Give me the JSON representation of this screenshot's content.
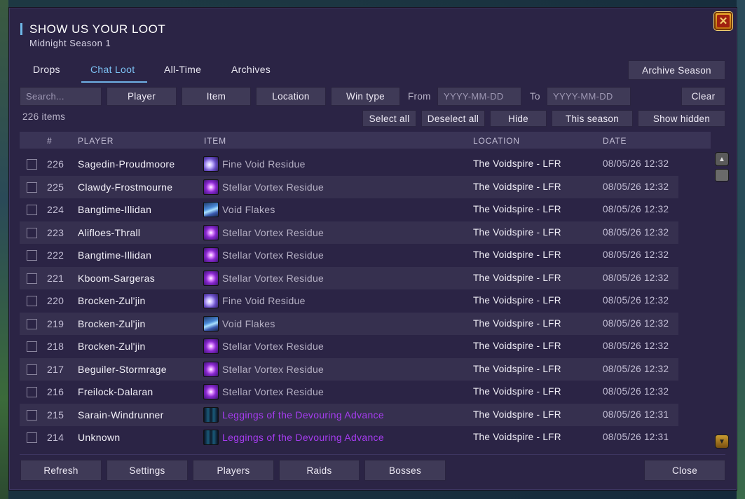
{
  "window": {
    "title": "SHOW US YOUR LOOT",
    "subtitle": "Midnight Season 1"
  },
  "tabs": [
    {
      "label": "Drops",
      "active": false
    },
    {
      "label": "Chat Loot",
      "active": true
    },
    {
      "label": "All-Time",
      "active": false
    },
    {
      "label": "Archives",
      "active": false
    }
  ],
  "archive_button": "Archive Season",
  "filters": {
    "search_placeholder": "Search...",
    "player": "Player",
    "item": "Item",
    "location": "Location",
    "win_type": "Win type",
    "from_label": "From",
    "from_placeholder": "YYYY-MM-DD",
    "to_label": "To",
    "to_placeholder": "YYYY-MM-DD",
    "clear": "Clear"
  },
  "count_text": "226 items",
  "actions": {
    "select_all": "Select all",
    "deselect_all": "Deselect all",
    "hide": "Hide",
    "this_season": "This season",
    "show_hidden": "Show hidden"
  },
  "columns": [
    "#",
    "PLAYER",
    "ITEM",
    "LOCATION",
    "DATE"
  ],
  "rows": [
    {
      "num": "226",
      "player": "Sagedin-Proudmoore",
      "icon": "fine-void-residue-icon",
      "item": "Fine Void Residue",
      "quality": "common",
      "location": "The Voidspire - LFR",
      "date": "08/05/26 12:32"
    },
    {
      "num": "225",
      "player": "Clawdy-Frostmourne",
      "icon": "stellar-vortex-residue-icon",
      "item": "Stellar Vortex Residue",
      "quality": "common",
      "location": "The Voidspire - LFR",
      "date": "08/05/26 12:32"
    },
    {
      "num": "224",
      "player": "Bangtime-Illidan",
      "icon": "void-flakes-icon",
      "item": "Void Flakes",
      "quality": "common",
      "location": "The Voidspire - LFR",
      "date": "08/05/26 12:32"
    },
    {
      "num": "223",
      "player": "Alifloes-Thrall",
      "icon": "stellar-vortex-residue-icon",
      "item": "Stellar Vortex Residue",
      "quality": "common",
      "location": "The Voidspire - LFR",
      "date": "08/05/26 12:32"
    },
    {
      "num": "222",
      "player": "Bangtime-Illidan",
      "icon": "stellar-vortex-residue-icon",
      "item": "Stellar Vortex Residue",
      "quality": "common",
      "location": "The Voidspire - LFR",
      "date": "08/05/26 12:32"
    },
    {
      "num": "221",
      "player": "Kboom-Sargeras",
      "icon": "stellar-vortex-residue-icon",
      "item": "Stellar Vortex Residue",
      "quality": "common",
      "location": "The Voidspire - LFR",
      "date": "08/05/26 12:32"
    },
    {
      "num": "220",
      "player": "Brocken-Zul'jin",
      "icon": "fine-void-residue-icon",
      "item": "Fine Void Residue",
      "quality": "common",
      "location": "The Voidspire - LFR",
      "date": "08/05/26 12:32"
    },
    {
      "num": "219",
      "player": "Brocken-Zul'jin",
      "icon": "void-flakes-icon",
      "item": "Void Flakes",
      "quality": "common",
      "location": "The Voidspire - LFR",
      "date": "08/05/26 12:32"
    },
    {
      "num": "218",
      "player": "Brocken-Zul'jin",
      "icon": "stellar-vortex-residue-icon",
      "item": "Stellar Vortex Residue",
      "quality": "common",
      "location": "The Voidspire - LFR",
      "date": "08/05/26 12:32"
    },
    {
      "num": "217",
      "player": "Beguiler-Stormrage",
      "icon": "stellar-vortex-residue-icon",
      "item": "Stellar Vortex Residue",
      "quality": "common",
      "location": "The Voidspire - LFR",
      "date": "08/05/26 12:32"
    },
    {
      "num": "216",
      "player": "Freilock-Dalaran",
      "icon": "stellar-vortex-residue-icon",
      "item": "Stellar Vortex Residue",
      "quality": "common",
      "location": "The Voidspire - LFR",
      "date": "08/05/26 12:32"
    },
    {
      "num": "215",
      "player": "Sarain-Windrunner",
      "icon": "leggings-icon",
      "item": "Leggings of the Devouring Advance",
      "quality": "epic",
      "location": "The Voidspire - LFR",
      "date": "08/05/26 12:31"
    },
    {
      "num": "214",
      "player": "Unknown",
      "icon": "leggings-icon",
      "item": "Leggings of the Devouring Advance",
      "quality": "epic",
      "location": "The Voidspire - LFR",
      "date": "08/05/26 12:31"
    }
  ],
  "footer": {
    "refresh": "Refresh",
    "settings": "Settings",
    "players": "Players",
    "raids": "Raids",
    "bosses": "Bosses",
    "close": "Close"
  },
  "colors": {
    "panel": "#2b2445",
    "accent": "#7cc0f2",
    "epic": "#a63cf0"
  }
}
